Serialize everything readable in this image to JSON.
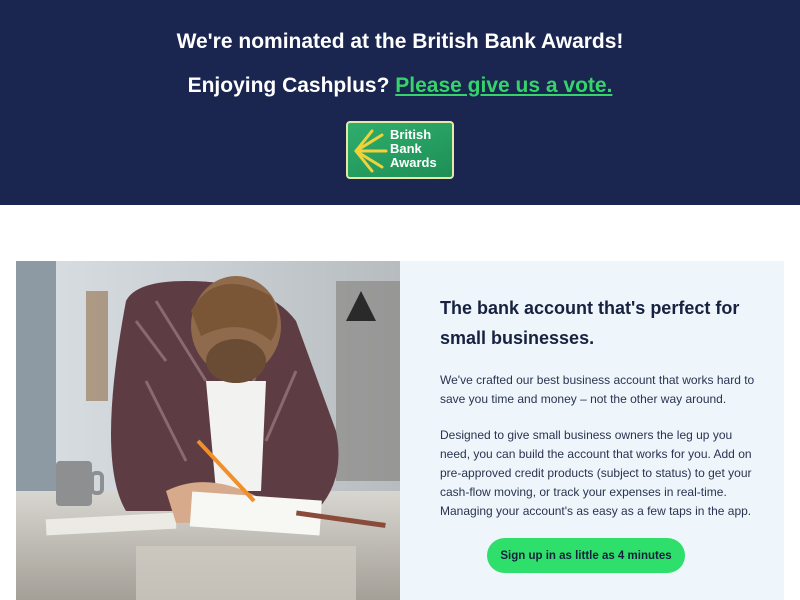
{
  "banner": {
    "headline": "We're nominated at the British Bank Awards!",
    "cta_prefix": "Enjoying Cashplus?",
    "cta_link": "Please give us a vote.",
    "badge": {
      "lines": [
        "British",
        "Bank",
        "Awards"
      ]
    }
  },
  "colors": {
    "banner_bg": "#1a2650",
    "accent_green": "#35d46a",
    "panel_bg": "#eef5fb",
    "button_bg": "#2fdf6b",
    "heading_text": "#172241"
  },
  "feature": {
    "title": "The bank account that's perfect for small businesses.",
    "paragraph1": "We've crafted our best business account that works hard to save you time and money – not the other way around.",
    "paragraph2": "Designed to give small business owners the leg up you need, you can build the account that works for you. Add on pre-approved credit products (subject to status) to get your cash-flow moving, or track your expenses in real-time. Managing your account's as easy as a few taps in the app.",
    "button_label": "Sign up in as little as 4 minutes"
  }
}
